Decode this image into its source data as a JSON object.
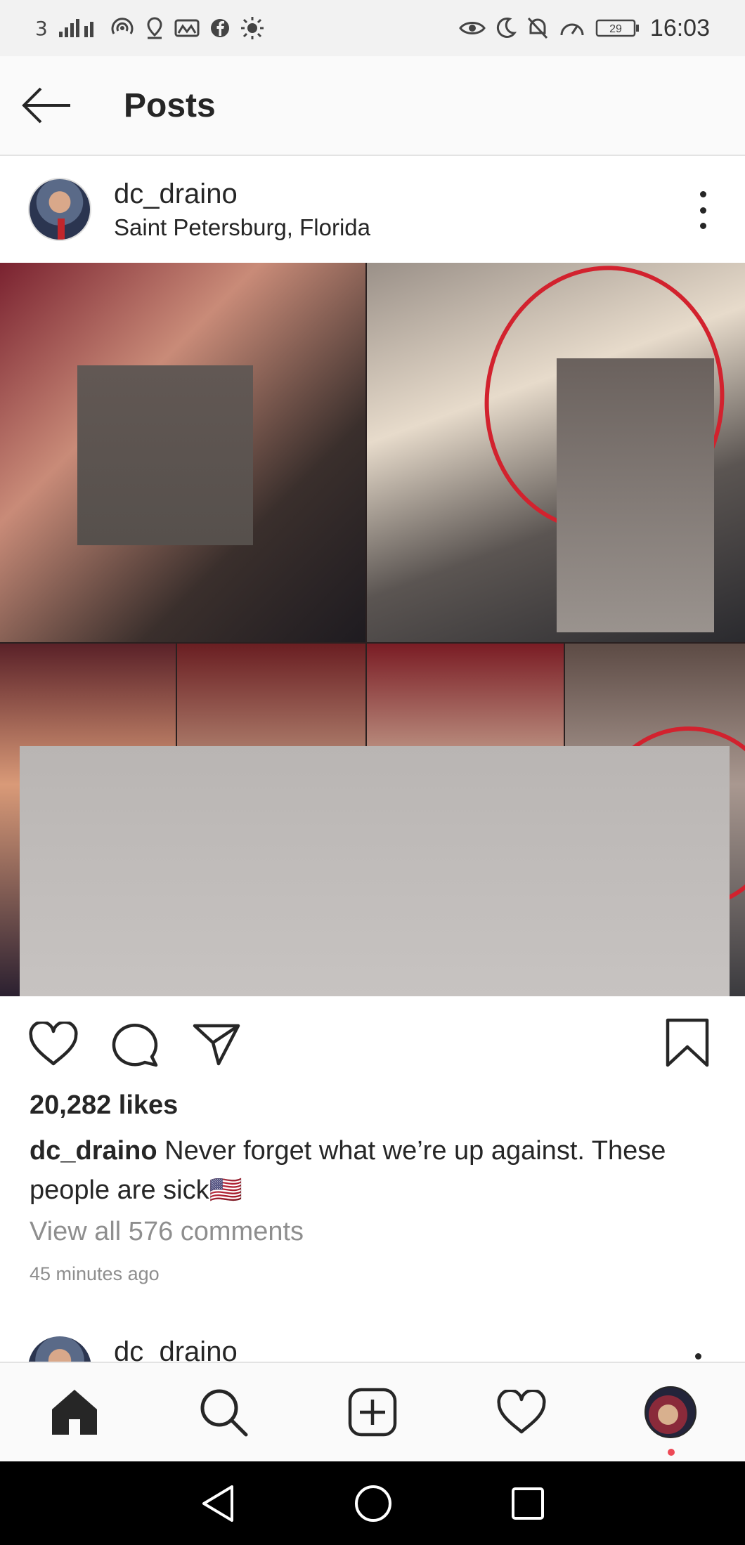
{
  "status_bar": {
    "left_text": "3",
    "time": "16:03",
    "battery": "29"
  },
  "header": {
    "title": "Posts"
  },
  "post": {
    "username": "dc_draino",
    "location": "Saint Petersburg, Florida",
    "likes": "20,282 likes",
    "caption_user": "dc_draino",
    "caption_text": "Never forget what we’re up against. These people are sick🇺🇸",
    "view_comments": "View all 576 comments",
    "time_ago": "45 minutes ago"
  },
  "next_post": {
    "username": "dc_draino"
  },
  "icons": {
    "back": "back-arrow-icon",
    "more": "more-vertical-icon",
    "like": "heart-icon",
    "comment": "comment-icon",
    "share": "send-icon",
    "save": "bookmark-icon",
    "home": "home-icon",
    "search": "search-icon",
    "new_post": "plus-square-icon",
    "activity": "heart-icon",
    "profile": "profile-avatar"
  },
  "colors": {
    "notification_dot": "#ed4956",
    "text": "#262626",
    "muted": "#8e8e8e"
  }
}
